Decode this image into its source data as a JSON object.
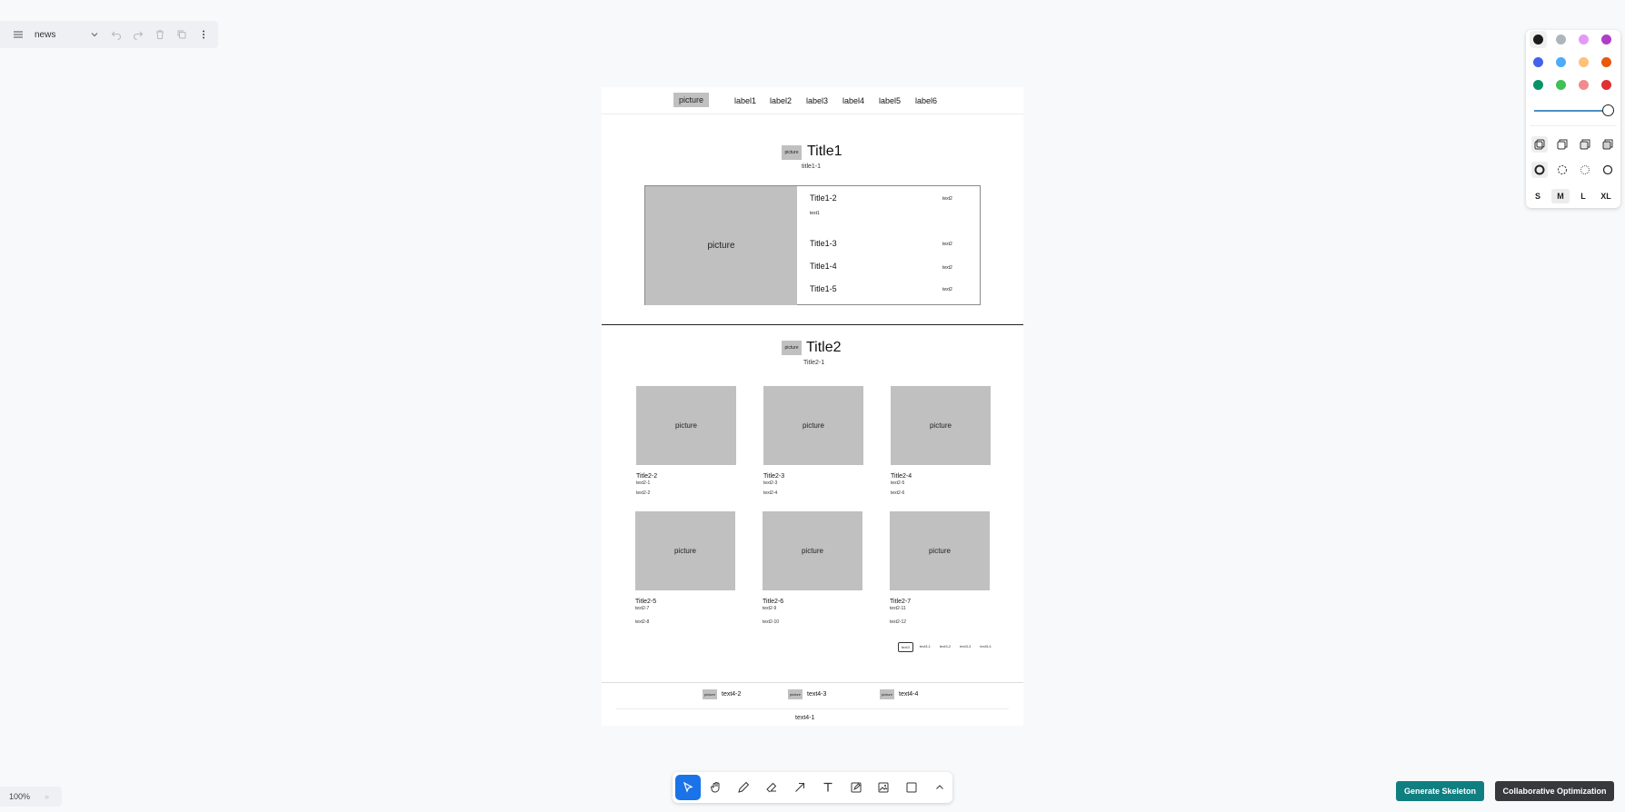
{
  "menu": {
    "doc_name": "news"
  },
  "nav": {
    "logo": "picture",
    "labels": [
      "label1",
      "label2",
      "label3",
      "label4",
      "label5",
      "label6"
    ]
  },
  "section1": {
    "icon": "picture",
    "title": "Title1",
    "subtitle": "title1-1",
    "feature_picture": "picture",
    "items": [
      {
        "title": "Title1-2",
        "meta": "text2",
        "desc": "text1"
      },
      {
        "title": "Title1-3",
        "meta": "text2"
      },
      {
        "title": "Title1-4",
        "meta": "text2"
      },
      {
        "title": "Title1-5",
        "meta": "text2"
      }
    ]
  },
  "section2": {
    "icon": "picture",
    "title": "Title2",
    "subtitle": "Title2-1",
    "cards": [
      {
        "picture": "picture",
        "title": "Title2-2",
        "line1": "text2-1",
        "line2": "text2-2"
      },
      {
        "picture": "picture",
        "title": "Title2-3",
        "line1": "text2-3",
        "line2": "text2-4"
      },
      {
        "picture": "picture",
        "title": "Title2-4",
        "line1": "text2-5",
        "line2": "text2-6"
      },
      {
        "picture": "picture",
        "title": "Title2-5",
        "line1": "text2-7",
        "line2": "text2-8"
      },
      {
        "picture": "picture",
        "title": "Title2-6",
        "line1": "text2-9",
        "line2": "text2-10"
      },
      {
        "picture": "picture",
        "title": "Title2-7",
        "line1": "text2-11",
        "line2": "text2-12"
      }
    ],
    "pager": [
      "text3",
      "text3-1",
      "text3-2",
      "text3-3",
      "text3-4"
    ]
  },
  "footer": {
    "items": [
      {
        "picture": "picture",
        "text": "text4-2"
      },
      {
        "picture": "picture",
        "text": "text4-3"
      },
      {
        "picture": "picture",
        "text": "text4-4"
      }
    ],
    "copyright": "text4-1"
  },
  "style_panel": {
    "colors": [
      "#1e1e1e",
      "#adb5bd",
      "#e599f7",
      "#ae3ec9",
      "#4263eb",
      "#4dabf7",
      "#ffc078",
      "#e8590c",
      "#099268",
      "#40c057",
      "#f08c8c",
      "#e03131"
    ],
    "selected_color": "#1e1e1e",
    "opacity": 1.0,
    "sizes": [
      "S",
      "M",
      "L",
      "XL"
    ],
    "selected_size": "M"
  },
  "zoom": {
    "level": "100%"
  },
  "actions": {
    "generate": "Generate Skeleton",
    "collaborate": "Collaborative Optimization"
  }
}
